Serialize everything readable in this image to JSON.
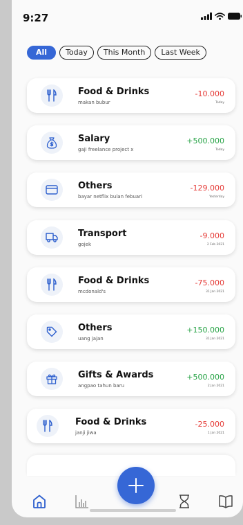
{
  "status_bar": {
    "time": "9:27"
  },
  "filters": [
    {
      "label": "All",
      "active": true
    },
    {
      "label": "Today",
      "active": false
    },
    {
      "label": "This Month",
      "active": false
    },
    {
      "label": "Last Week",
      "active": false
    }
  ],
  "transactions": [
    {
      "icon": "food-drinks-icon",
      "title": "Food & Drinks",
      "note": "makan bubur",
      "amount": "-10.000",
      "type": "negative",
      "date": "Today"
    },
    {
      "icon": "salary-money-bag-icon",
      "title": "Salary",
      "note": "gaji freelance project x",
      "amount": "+500.000",
      "type": "positive",
      "date": "Today"
    },
    {
      "icon": "card-icon",
      "title": "Others",
      "note": "bayar netflix bulan febuari",
      "amount": "-129.000",
      "type": "negative",
      "date": "Yesterday"
    },
    {
      "icon": "truck-icon",
      "title": "Transport",
      "note": "gojek",
      "amount": "-9.000",
      "type": "negative",
      "date": "2 Feb 2021"
    },
    {
      "icon": "food-drinks-icon",
      "title": "Food & Drinks",
      "note": "mcdonald's",
      "amount": "-75.000",
      "type": "negative",
      "date": "31 Jan 2021"
    },
    {
      "icon": "tag-icon",
      "title": "Others",
      "note": "uang jajan",
      "amount": "+150.000",
      "type": "positive",
      "date": "31 Jan 2021"
    },
    {
      "icon": "gift-icon",
      "title": "Gifts & Awards",
      "note": "angpao tahun baru",
      "amount": "+500.000",
      "type": "positive",
      "date": "2 Jan 2021"
    },
    {
      "icon": "food-drinks-icon",
      "title": "Food & Drinks",
      "note": "janji jiwa",
      "amount": "-25.000",
      "type": "negative",
      "date": "1 Jan 2021"
    }
  ],
  "colors": {
    "accent": "#3667d6",
    "negative": "#e53935",
    "positive": "#25a244"
  },
  "nav": [
    "home-icon",
    "chart-icon",
    "add-icon",
    "hourglass-icon",
    "book-icon"
  ]
}
